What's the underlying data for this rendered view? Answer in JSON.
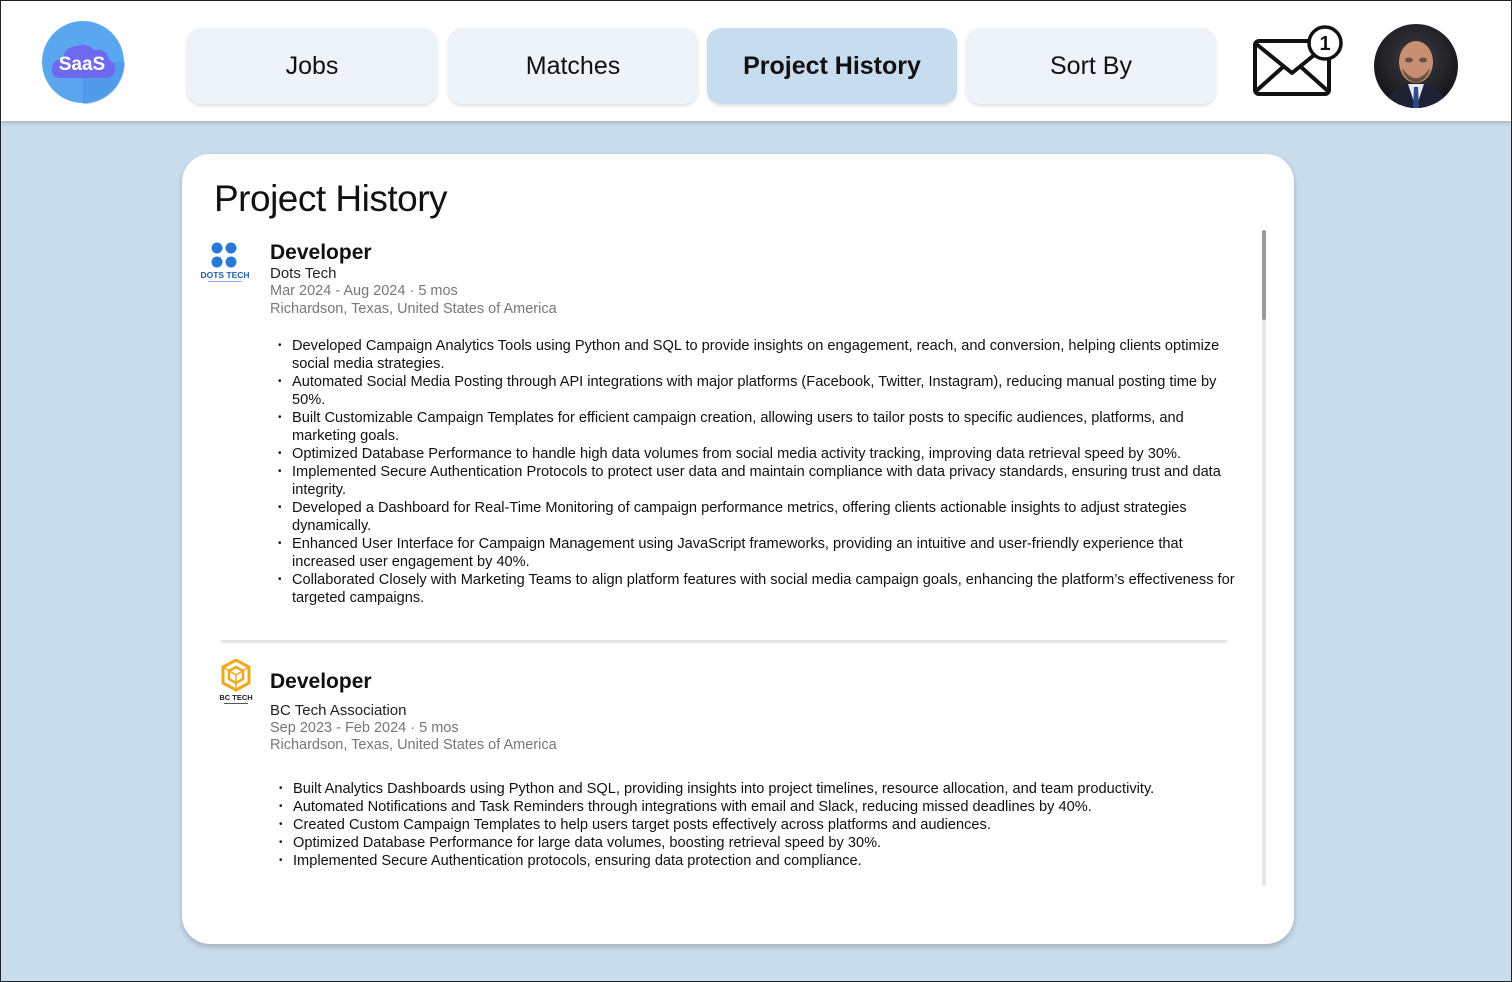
{
  "header": {
    "logo_text": "SaaS",
    "tabs": [
      {
        "label": "Jobs",
        "active": false
      },
      {
        "label": "Matches",
        "active": false
      },
      {
        "label": "Project History",
        "active": true
      },
      {
        "label": "Sort By",
        "active": false
      }
    ],
    "notification_count": "1"
  },
  "main": {
    "title": "Project History",
    "entries": [
      {
        "logo_text": "DOTS TECH",
        "title": "Developer",
        "company": "Dots Tech",
        "dates": "Mar 2024  -  Aug 2024 · 5 mos",
        "location": "Richardson, Texas, United States of America",
        "bullets": [
          "Developed Campaign Analytics Tools using Python and SQL to provide insights on engagement, reach, and conversion, helping clients optimize social media strategies.",
          "Automated Social Media Posting through API integrations with major platforms (Facebook, Twitter, Instagram), reducing manual posting time by 50%.",
          "Built Customizable Campaign Templates for efficient campaign creation, allowing users to tailor posts to specific audiences, platforms, and marketing goals.",
          "Optimized Database Performance to handle high data volumes from social media activity tracking, improving data retrieval speed by 30%.",
          "Implemented Secure Authentication Protocols to protect user data and maintain compliance with data privacy standards, ensuring trust and data integrity.",
          "Developed a Dashboard for Real-Time Monitoring of campaign performance metrics, offering clients actionable insights to adjust strategies dynamically.",
          "Enhanced User Interface for Campaign Management using JavaScript frameworks, providing an intuitive and user-friendly experience that increased user engagement by 40%.",
          "Collaborated Closely with Marketing Teams to align platform features with social media campaign goals, enhancing the platform’s effectiveness for targeted campaigns."
        ]
      },
      {
        "logo_text": "BC TECH",
        "title": "Developer",
        "company": "BC Tech Association",
        "dates": "Sep 2023  -  Feb 2024 · 5 mos",
        "location": "Richardson, Texas, United States of America",
        "bullets": [
          "Built Analytics Dashboards using Python and SQL, providing insights into project timelines, resource allocation, and team productivity.",
          "Automated Notifications and Task Reminders through integrations with email and Slack, reducing missed deadlines by 40%.",
          "Created Custom Campaign Templates to help users target posts effectively across platforms and audiences.",
          "Optimized Database Performance for large data volumes, boosting retrieval speed by 30%.",
          "Implemented Secure Authentication protocols, ensuring data protection and compliance."
        ]
      }
    ]
  },
  "colors": {
    "background": "#c9dcec",
    "tab": "#edf3f9",
    "tab_active": "#c8dcf0",
    "logo_blue": "#4a8df0"
  }
}
